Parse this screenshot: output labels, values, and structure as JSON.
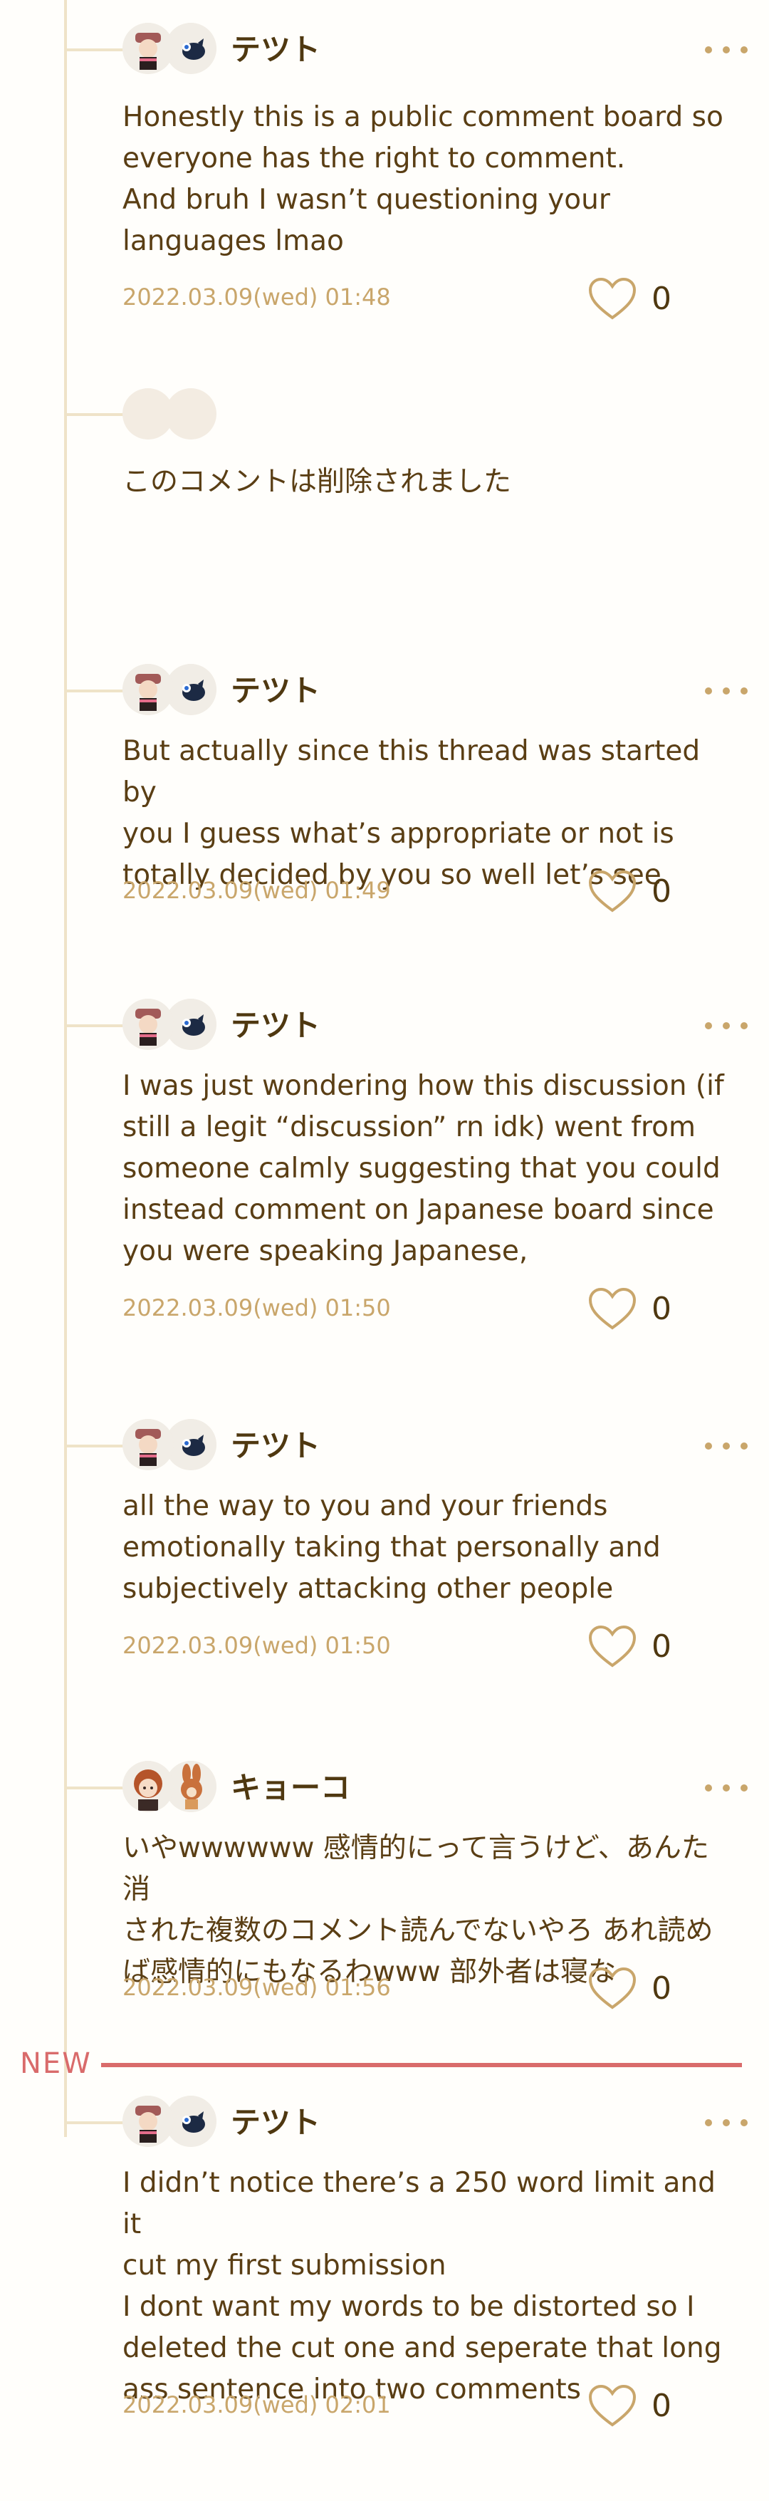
{
  "comments": [
    {
      "user": "テツト",
      "text": "Honestly this is a public comment board so\neveryone has the right to comment.\nAnd bruh I wasn’t questioning your\nlanguages lmao",
      "timestamp": "2022.03.09(wed) 01:48",
      "likes": "0"
    },
    {
      "deleted_text": "このコメントは削除されました"
    },
    {
      "user": "テツト",
      "text": "But actually since this thread was started by\nyou I guess what’s appropriate or not is\ntotally decided by you so well let’s see",
      "timestamp": "2022.03.09(wed) 01:49",
      "likes": "0"
    },
    {
      "user": "テツト",
      "text": "I was just wondering how this discussion (if\nstill a legit “discussion” rn idk) went from\nsomeone calmly suggesting that you could\ninstead comment on Japanese board since\nyou were speaking Japanese,",
      "timestamp": "2022.03.09(wed) 01:50",
      "likes": "0"
    },
    {
      "user": "テツト",
      "text": "all the way to you and your friends\nemotionally taking that personally and\nsubjectively attacking other people",
      "timestamp": "2022.03.09(wed) 01:50",
      "likes": "0"
    },
    {
      "user": "キョーコ",
      "text": "いやwwwwww 感情的にって言うけど、あんた消\nされた複数のコメント読んでないやろ あれ読め\nば感情的にもなるわwww 部外者は寝な",
      "timestamp": "2022.03.09(wed) 01:56",
      "likes": "0"
    },
    {
      "user": "テツト",
      "text": "I didn’t notice there’s a 250 word limit and it\ncut my first submission\nI dont want my words to be distorted so I\ndeleted the cut one and seperate that long\nass sentence into two comments",
      "timestamp": "2022.03.09(wed) 02:01",
      "likes": "0"
    }
  ],
  "new_marker": "NEW",
  "colors": {
    "accent": "#c9a66b",
    "text": "#5a3e14",
    "new": "#d96b6b",
    "thread": "#efe3c8"
  },
  "icons": {
    "more": "more-dots-icon",
    "like": "heart-icon"
  }
}
